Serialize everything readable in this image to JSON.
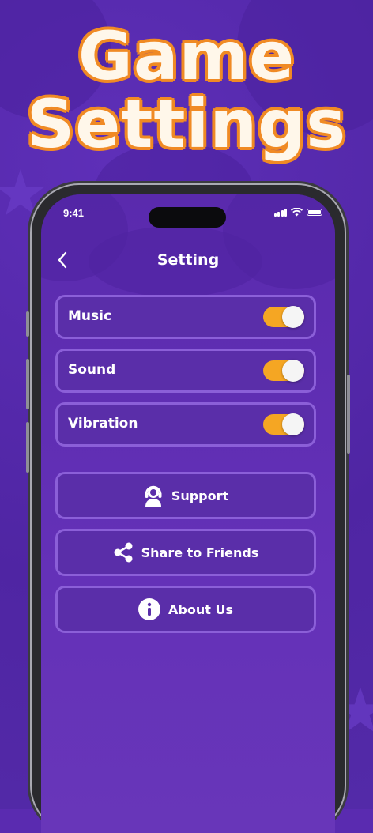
{
  "headline": {
    "line1": "Game",
    "line2": "Settings"
  },
  "status_bar": {
    "time": "9:41"
  },
  "nav": {
    "back_icon": "chevron-left-icon",
    "title": "Setting"
  },
  "toggles": [
    {
      "label": "Music",
      "on": true
    },
    {
      "label": "Sound",
      "on": true
    },
    {
      "label": "Vibration",
      "on": true
    }
  ],
  "buttons": [
    {
      "label": "Support",
      "icon": "support-agent-icon"
    },
    {
      "label": "Share to Friends",
      "icon": "share-icon"
    },
    {
      "label": "About Us",
      "icon": "info-icon"
    }
  ],
  "colors": {
    "background": "#5a2bb0",
    "toggle_on": "#f5a623",
    "border": "#8b5fd8",
    "headline_outline": "#f08a24"
  }
}
